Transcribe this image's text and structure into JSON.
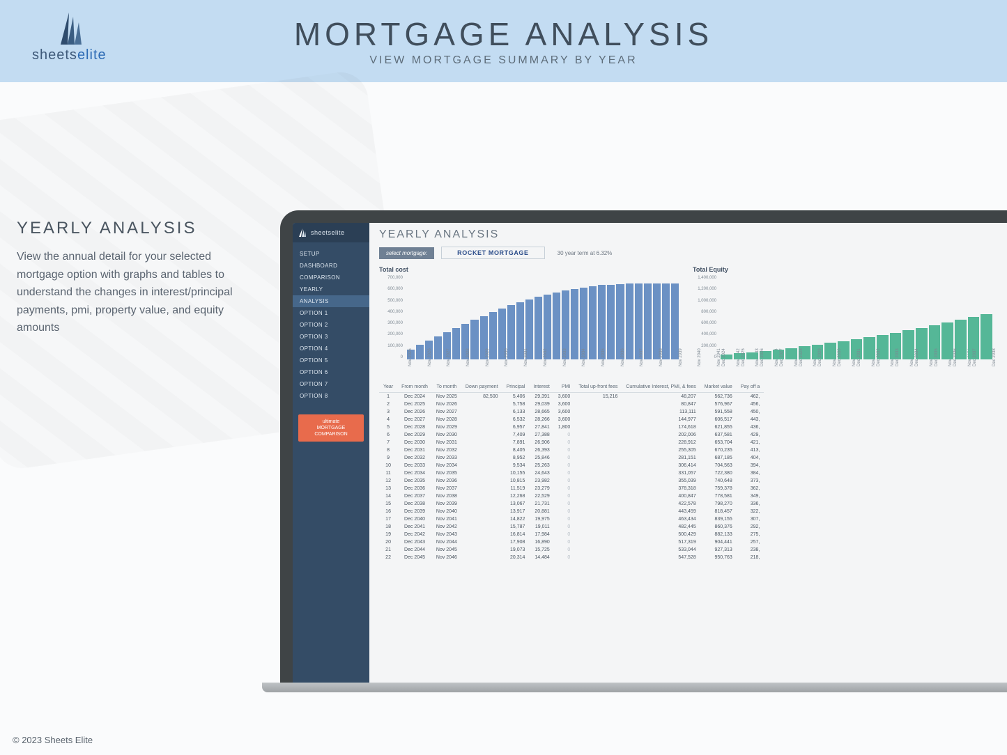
{
  "banner": {
    "brand_a": "sheets",
    "brand_b": "elite",
    "title": "MORTGAGE ANALYSIS",
    "subtitle": "VIEW MORTGAGE SUMMARY BY YEAR"
  },
  "copy": {
    "heading": "YEARLY ANALYSIS",
    "body": "View the annual detail for your selected mortgage option with graphs and tables to understand the changes in interest/principal payments, pmi, property value, and equity amounts"
  },
  "nav": {
    "items": [
      "SETUP",
      "DASHBOARD",
      "COMPARISON",
      "YEARLY",
      "ANALYSIS",
      "OPTION 1",
      "OPTION 2",
      "OPTION 3",
      "OPTION 4",
      "OPTION 5",
      "OPTION 6",
      "OPTION 7",
      "OPTION 8"
    ],
    "active_index": 4,
    "cta_l1": "ultimate",
    "cta_l2": "MORTGAGE",
    "cta_l3": "COMPARISON"
  },
  "sheet": {
    "title": "YEARLY ANALYSIS",
    "select_label": "select mortgage:",
    "select_value": "ROCKET MORTGAGE",
    "term": "30 year term at 6.32%"
  },
  "cost_chart_title": "Total cost",
  "equity_chart_title": "Total Equity",
  "cost_y_labels": [
    "700,000",
    "600,000",
    "500,000",
    "400,000",
    "300,000",
    "200,000",
    "100,000",
    "0"
  ],
  "equity_y_labels": [
    "1,400,000",
    "1,200,000",
    "1,000,000",
    "800,000",
    "600,000",
    "400,000",
    "200,000",
    "0"
  ],
  "chart_data": [
    {
      "type": "bar",
      "title": "Total cost",
      "categories": [
        "Nov 2025",
        "Nov 2026",
        "Nov 2027",
        "Nov 2028",
        "Nov 2029",
        "Nov 2030",
        "Nov 2031",
        "Nov 2032",
        "Nov 2033",
        "Nov 2034",
        "Nov 2035",
        "Nov 2036",
        "Nov 2037",
        "Nov 2038",
        "Nov 2039",
        "Nov 2040",
        "Nov 2041",
        "Nov 2042",
        "Nov 2043",
        "Nov 2044",
        "Nov 2045",
        "Nov 2046",
        "Nov 2047",
        "Nov 2048",
        "Nov 2049",
        "Nov 2050",
        "Nov 2051",
        "Nov 2052",
        "Nov 2053",
        "Nov 2054"
      ],
      "values": [
        82000,
        120000,
        155000,
        190000,
        225000,
        262000,
        296000,
        330000,
        364000,
        396000,
        428000,
        455000,
        480000,
        504000,
        525000,
        545000,
        562000,
        578000,
        590000,
        602000,
        613000,
        622000,
        627000,
        632000,
        635000,
        636000,
        636000,
        636000,
        636000,
        636000
      ],
      "ylabel": "",
      "xlabel": "",
      "ylim": [
        0,
        700000
      ]
    },
    {
      "type": "bar",
      "title": "Total Equity",
      "categories": [
        "Dec 2024",
        "Dec 2025",
        "Dec 2026",
        "Dec 2027",
        "Dec 2028",
        "Dec 2029",
        "Dec 2030",
        "Dec 2031",
        "Dec 2032",
        "Dec 2033",
        "Dec 2034",
        "Dec 2035",
        "Dec 2036",
        "Dec 2037",
        "Dec 2038",
        "Dec 2039",
        "Dec 2040",
        "Dec 2041",
        "Dec 2042",
        "Dec 2043",
        "Dec 2044"
      ],
      "values": [
        82000,
        100000,
        120000,
        142000,
        165000,
        190000,
        218000,
        246000,
        276000,
        308000,
        340000,
        375000,
        410000,
        448000,
        487000,
        528000,
        570000,
        615000,
        660000,
        707000,
        755000
      ],
      "ylabel": "",
      "xlabel": "",
      "ylim": [
        0,
        1400000
      ]
    }
  ],
  "table": {
    "headers": [
      "Year",
      "From month",
      "To month",
      "Down payment",
      "Principal",
      "Interest",
      "PMI",
      "Total up-front fees",
      "Cumulative Interest, PMI, & fees",
      "Market value",
      "Pay off a"
    ],
    "rows": [
      [
        "1",
        "Dec 2024",
        "Nov 2025",
        "82,500",
        "5,406",
        "29,391",
        "3,600",
        "15,216",
        "48,207",
        "562,736",
        "462,"
      ],
      [
        "2",
        "Dec 2025",
        "Nov 2026",
        "",
        "5,758",
        "29,039",
        "3,600",
        "",
        "80,847",
        "576,967",
        "456,"
      ],
      [
        "3",
        "Dec 2026",
        "Nov 2027",
        "",
        "6,133",
        "28,665",
        "3,600",
        "",
        "113,111",
        "591,558",
        "450,"
      ],
      [
        "4",
        "Dec 2027",
        "Nov 2028",
        "",
        "6,532",
        "28,266",
        "3,600",
        "",
        "144,977",
        "606,517",
        "443,"
      ],
      [
        "5",
        "Dec 2028",
        "Nov 2029",
        "",
        "6,957",
        "27,841",
        "1,800",
        "",
        "174,618",
        "621,855",
        "436,"
      ],
      [
        "6",
        "Dec 2029",
        "Nov 2030",
        "",
        "7,409",
        "27,388",
        "0",
        "",
        "202,006",
        "637,581",
        "429,"
      ],
      [
        "7",
        "Dec 2030",
        "Nov 2031",
        "",
        "7,891",
        "26,906",
        "0",
        "",
        "228,912",
        "653,704",
        "421,"
      ],
      [
        "8",
        "Dec 2031",
        "Nov 2032",
        "",
        "8,405",
        "26,393",
        "0",
        "",
        "255,305",
        "670,235",
        "413,"
      ],
      [
        "9",
        "Dec 2032",
        "Nov 2033",
        "",
        "8,952",
        "25,846",
        "0",
        "",
        "281,151",
        "687,185",
        "404,"
      ],
      [
        "10",
        "Dec 2033",
        "Nov 2034",
        "",
        "9,534",
        "25,263",
        "0",
        "",
        "306,414",
        "704,563",
        "394,"
      ],
      [
        "11",
        "Dec 2034",
        "Nov 2035",
        "",
        "10,155",
        "24,643",
        "0",
        "",
        "331,057",
        "722,380",
        "384,"
      ],
      [
        "12",
        "Dec 2035",
        "Nov 2036",
        "",
        "10,815",
        "23,982",
        "0",
        "",
        "355,039",
        "740,648",
        "373,"
      ],
      [
        "13",
        "Dec 2036",
        "Nov 2037",
        "",
        "11,519",
        "23,279",
        "0",
        "",
        "378,318",
        "759,378",
        "362,"
      ],
      [
        "14",
        "Dec 2037",
        "Nov 2038",
        "",
        "12,268",
        "22,529",
        "0",
        "",
        "400,847",
        "778,581",
        "349,"
      ],
      [
        "15",
        "Dec 2038",
        "Nov 2039",
        "",
        "13,067",
        "21,731",
        "0",
        "",
        "422,578",
        "798,270",
        "336,"
      ],
      [
        "16",
        "Dec 2039",
        "Nov 2040",
        "",
        "13,917",
        "20,881",
        "0",
        "",
        "443,459",
        "818,457",
        "322,"
      ],
      [
        "17",
        "Dec 2040",
        "Nov 2041",
        "",
        "14,822",
        "19,975",
        "0",
        "",
        "463,434",
        "839,155",
        "307,"
      ],
      [
        "18",
        "Dec 2041",
        "Nov 2042",
        "",
        "15,787",
        "19,011",
        "0",
        "",
        "482,445",
        "860,376",
        "292,"
      ],
      [
        "19",
        "Dec 2042",
        "Nov 2043",
        "",
        "16,814",
        "17,984",
        "0",
        "",
        "500,429",
        "882,133",
        "275,"
      ],
      [
        "20",
        "Dec 2043",
        "Nov 2044",
        "",
        "17,908",
        "16,890",
        "0",
        "",
        "517,319",
        "904,441",
        "257,"
      ],
      [
        "21",
        "Dec 2044",
        "Nov 2045",
        "",
        "19,073",
        "15,725",
        "0",
        "",
        "533,044",
        "927,313",
        "238,"
      ],
      [
        "22",
        "Dec 2045",
        "Nov 2046",
        "",
        "20,314",
        "14,484",
        "0",
        "",
        "547,528",
        "950,763",
        "218,"
      ]
    ]
  },
  "footer": "© 2023 Sheets Elite"
}
